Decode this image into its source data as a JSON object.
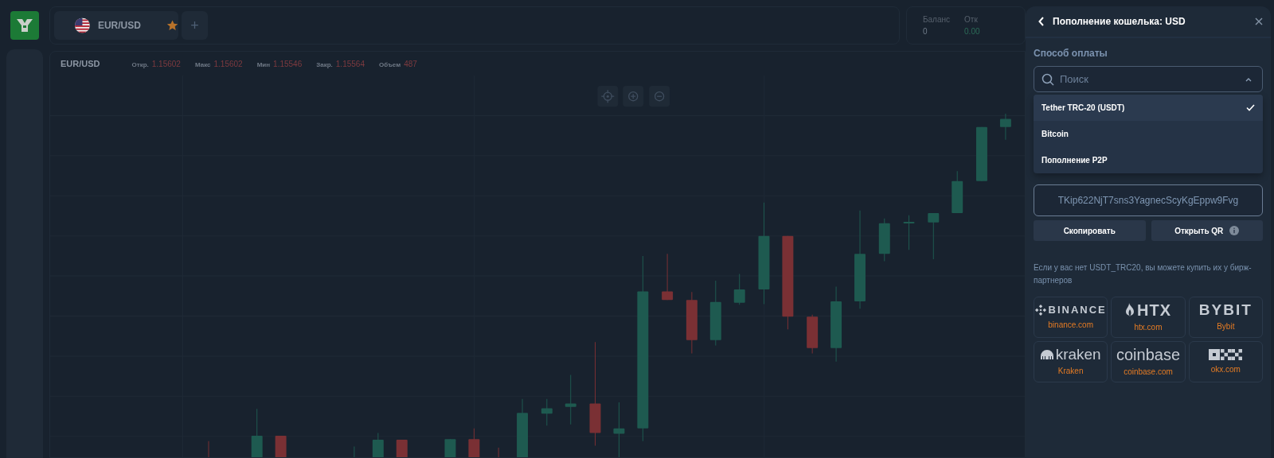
{
  "tabs": [
    {
      "label": "EUR/USD",
      "selected": true,
      "favorite": true
    }
  ],
  "add_tab": "+",
  "balance": {
    "label": "Баланс",
    "value": "0"
  },
  "balance_2": {
    "label": "Отк",
    "value": "0.00"
  },
  "chart": {
    "symbol": "EUR/USD",
    "stats": [
      {
        "label": "Откр.",
        "value": "1.15602"
      },
      {
        "label": "Макс",
        "value": "1.15602"
      },
      {
        "label": "Мин",
        "value": "1.15546"
      },
      {
        "label": "Закр.",
        "value": "1.15564"
      },
      {
        "label": "Объем",
        "value": "487"
      }
    ]
  },
  "panel": {
    "title": "Пополнение кошелька: USD",
    "method_label": "Способ оплаты",
    "search": {
      "placeholder": "Поиск",
      "expanded": true
    },
    "options": [
      {
        "label": "Tether TRC-20 (USDT)",
        "selected": true
      },
      {
        "label": "Bitcoin",
        "selected": false
      },
      {
        "label": "Пополнение P2P",
        "selected": false
      }
    ],
    "address": "TKip622NjT7sns3YagnecScyKgEppw9Fvg",
    "buttons": [
      {
        "label": "Скопировать",
        "info": false
      },
      {
        "label": "Открыть QR",
        "info": true
      }
    ],
    "note": "Если у вас нет USDT_TRC20, вы можете купить их у бирж-партнеров",
    "exchanges": [
      {
        "kind": "binance",
        "logo": "BINANCE",
        "link": "binance.com"
      },
      {
        "kind": "htx",
        "logo": "HTX",
        "link": "htx.com"
      },
      {
        "kind": "bybit",
        "logo": "BYBIT",
        "link": "Bybit"
      },
      {
        "kind": "kraken",
        "logo": "kraken",
        "link": "Kraken"
      },
      {
        "kind": "coinbase",
        "logo": "coinbase",
        "link": "coinbase.com"
      },
      {
        "kind": "okx",
        "link": "okx.com"
      }
    ]
  }
}
